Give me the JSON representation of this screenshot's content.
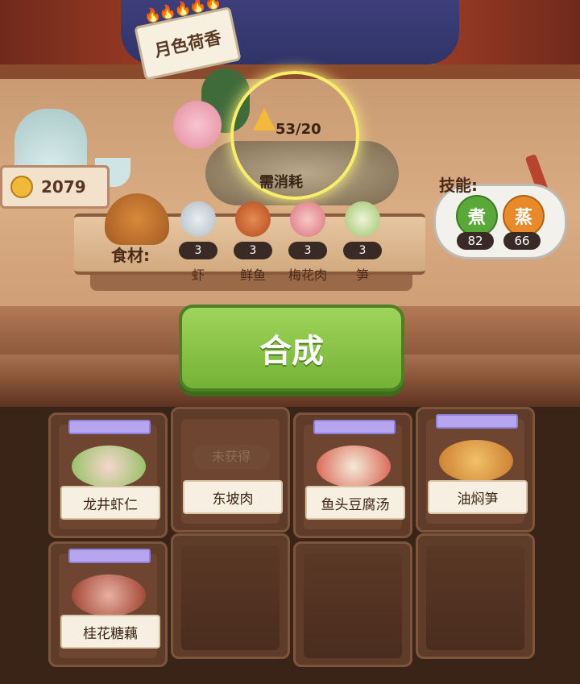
{
  "header": {
    "recipe_title": "月色荷香",
    "flames": "🔥🔥🔥🔥🔥"
  },
  "currency": {
    "coins": "2079"
  },
  "requirement": {
    "count": "53/20",
    "label": "需消耗"
  },
  "ingredients": {
    "label": "食材:",
    "items": [
      {
        "name": "虾",
        "count": "3"
      },
      {
        "name": "鲜鱼",
        "count": "3"
      },
      {
        "name": "梅花肉",
        "count": "3"
      },
      {
        "name": "笋",
        "count": "3"
      }
    ]
  },
  "skills": {
    "label": "技能:",
    "items": [
      {
        "name": "煮",
        "value": "82",
        "color": "#5aa83a"
      },
      {
        "name": "蒸",
        "value": "66",
        "color": "#e98a2a"
      }
    ]
  },
  "actions": {
    "synthesize_label": "合成"
  },
  "recipes": [
    {
      "name": "龙井虾仁",
      "status": "unlocked"
    },
    {
      "name": "东坡肉",
      "status": "locked",
      "locked_text": "未获得"
    },
    {
      "name": "鱼头豆腐汤",
      "status": "unlocked"
    },
    {
      "name": "油焖笋",
      "status": "unlocked"
    },
    {
      "name": "桂花糖藕",
      "status": "unlocked"
    }
  ]
}
